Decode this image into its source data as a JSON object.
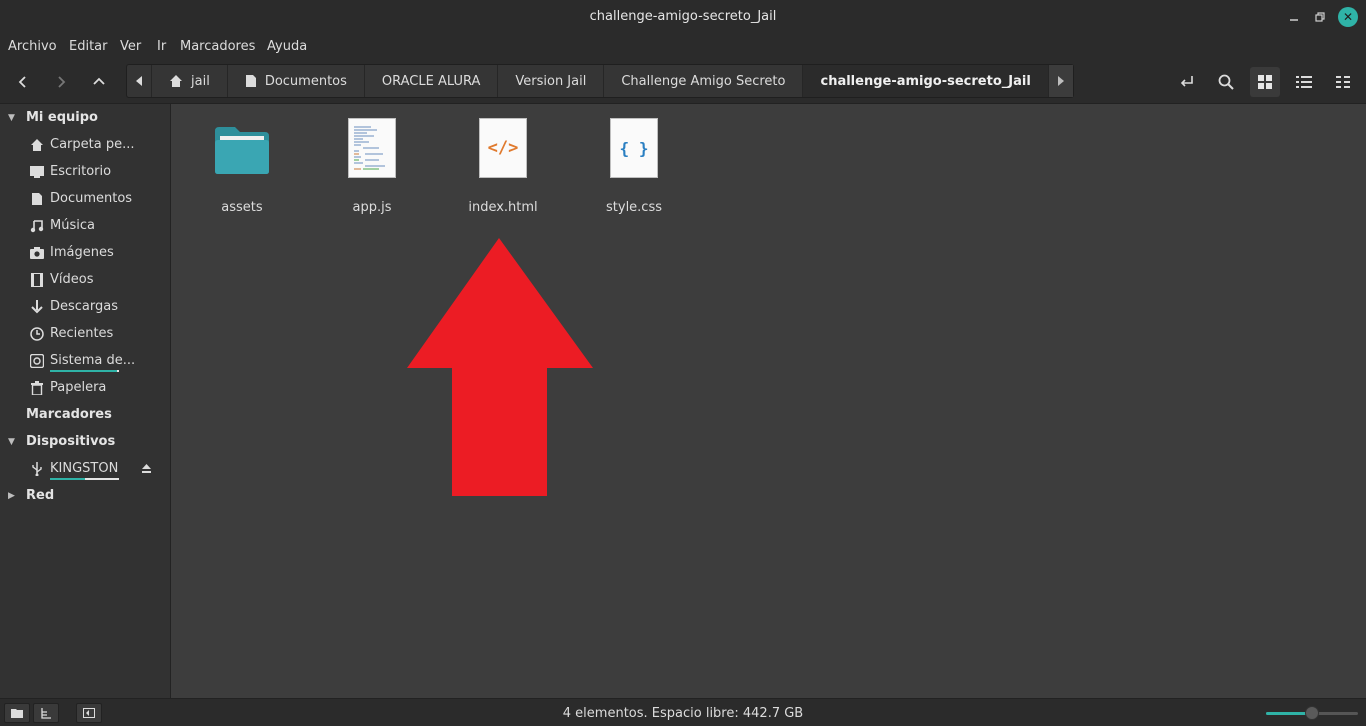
{
  "window": {
    "title": "challenge-amigo-secreto_Jail"
  },
  "menu": [
    "Archivo",
    "Editar",
    "Ver",
    "Ir",
    "Marcadores",
    "Ayuda"
  ],
  "breadcrumbs": [
    {
      "label": "jail",
      "icon": "home-icon"
    },
    {
      "label": "Documentos",
      "icon": "document-icon"
    },
    {
      "label": "ORACLE ALURA"
    },
    {
      "label": "Version Jail"
    },
    {
      "label": "Challenge Amigo Secreto"
    },
    {
      "label": "challenge-amigo-secreto_Jail",
      "active": true
    }
  ],
  "sidebar": {
    "sections": {
      "mi_equipo": "Mi equipo",
      "marcadores": "Marcadores",
      "dispositivos": "Dispositivos",
      "red": "Red"
    },
    "items": [
      {
        "label": "Carpeta pe...",
        "icon": "home-icon"
      },
      {
        "label": "Escritorio",
        "icon": "desktop-icon"
      },
      {
        "label": "Documentos",
        "icon": "document-icon"
      },
      {
        "label": "Música",
        "icon": "music-icon"
      },
      {
        "label": "Imágenes",
        "icon": "camera-icon"
      },
      {
        "label": "Vídeos",
        "icon": "film-icon"
      },
      {
        "label": "Descargas",
        "icon": "download-icon"
      },
      {
        "label": "Recientes",
        "icon": "clock-icon"
      },
      {
        "label": "Sistema de...",
        "icon": "drive-icon",
        "usage": 0.97
      },
      {
        "label": "Papelera",
        "icon": "trash-icon"
      }
    ],
    "devices": [
      {
        "label": "KINGSTON",
        "icon": "usb-icon",
        "usage": 0.5
      }
    ]
  },
  "files": [
    {
      "name": "assets",
      "type": "folder"
    },
    {
      "name": "app.js",
      "type": "js"
    },
    {
      "name": "index.html",
      "type": "html",
      "glyph": "</>"
    },
    {
      "name": "style.css",
      "type": "css",
      "glyph": "{ }"
    }
  ],
  "status": {
    "text": "4 elementos. Espacio libre: 442.7 GB",
    "zoom": 0.5
  },
  "colors": {
    "accent": "#2fb3a7",
    "arrow": "#ec1c24",
    "folder": "#3aa6b3"
  }
}
